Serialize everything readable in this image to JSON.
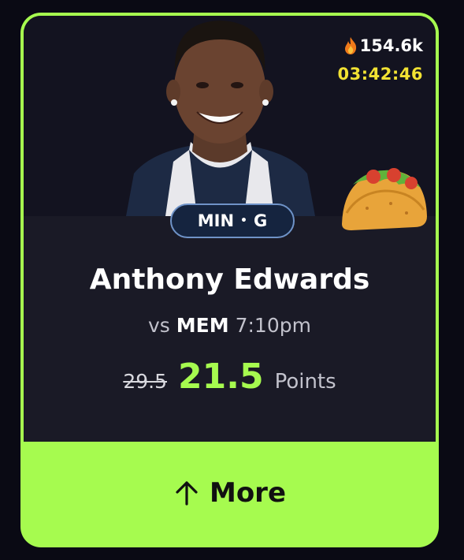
{
  "card": {
    "popularity": "154.6k",
    "countdown": "03:42:46",
    "badge": {
      "team": "MIN",
      "separator": "•",
      "position": "G"
    },
    "player_name": "Anthony Edwards",
    "matchup": {
      "prefix": "vs",
      "opponent": "MEM",
      "time": "7:10pm"
    },
    "line": {
      "previous": "29.5",
      "current": "21.5",
      "stat": "Points"
    },
    "more_label": "More"
  },
  "icons": {
    "popularity": "flame-icon",
    "promo": "taco-icon",
    "more": "arrow-up-icon"
  },
  "colors": {
    "accent_green": "#a6fb4f",
    "panel": "#1a1a26",
    "countdown_yellow": "#f2e233",
    "badge_bg": "#15243f",
    "badge_border": "#6f93c8"
  }
}
